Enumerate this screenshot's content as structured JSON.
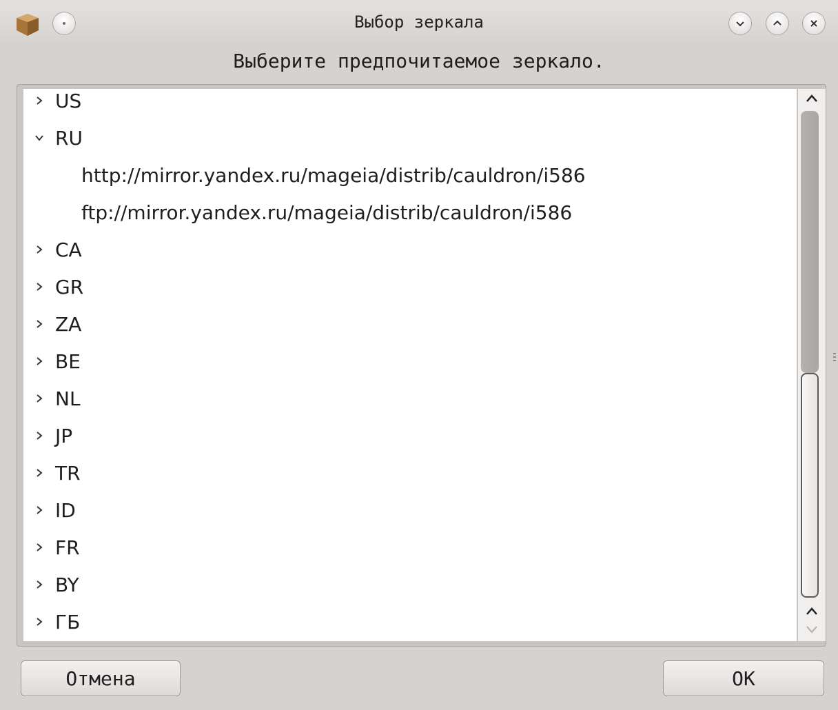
{
  "window": {
    "title": "Выбор зеркала",
    "icons": {
      "app": "package-box-icon",
      "menu": "window-menu-icon",
      "minimize": "chevron-down-icon",
      "maximize": "chevron-up-icon",
      "close": "close-icon"
    }
  },
  "prompt": "Выберите предпочитаемое зеркало.",
  "tree": {
    "items": [
      {
        "label": "US",
        "expanded": false
      },
      {
        "label": "RU",
        "expanded": true
      },
      {
        "label": "http://mirror.yandex.ru/mageia/distrib/cauldron/i586",
        "child": true
      },
      {
        "label": "ftp://mirror.yandex.ru/mageia/distrib/cauldron/i586",
        "child": true
      },
      {
        "label": "CA",
        "expanded": false
      },
      {
        "label": "GR",
        "expanded": false
      },
      {
        "label": "ZA",
        "expanded": false
      },
      {
        "label": "BE",
        "expanded": false
      },
      {
        "label": "NL",
        "expanded": false
      },
      {
        "label": "JP",
        "expanded": false
      },
      {
        "label": "TR",
        "expanded": false
      },
      {
        "label": "ID",
        "expanded": false
      },
      {
        "label": "FR",
        "expanded": false
      },
      {
        "label": "BY",
        "expanded": false
      },
      {
        "label": "ГБ",
        "expanded": false
      }
    ]
  },
  "buttons": {
    "cancel": "Отмена",
    "ok": "OK"
  },
  "colors": {
    "window_bg": "#d6d2d0",
    "list_bg": "#ffffff",
    "text": "#1e1e1e"
  }
}
